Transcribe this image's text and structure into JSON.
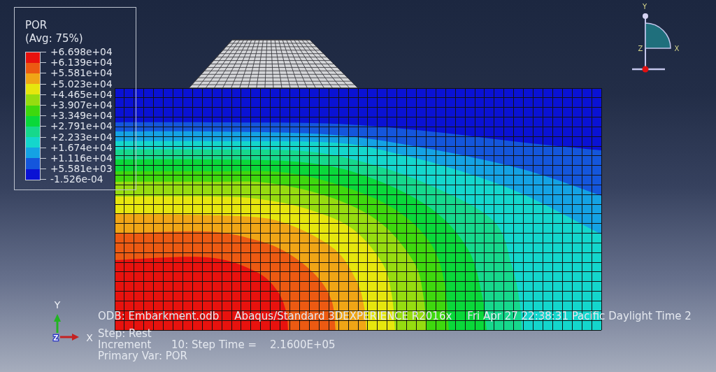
{
  "legend": {
    "title": "POR",
    "subtitle": "(Avg: 75%)",
    "bands": [
      {
        "color": "#e8120e"
      },
      {
        "color": "#ec5a12"
      },
      {
        "color": "#f0a516"
      },
      {
        "color": "#e6e60e"
      },
      {
        "color": "#96dc10"
      },
      {
        "color": "#3ed80e"
      },
      {
        "color": "#0ad83a"
      },
      {
        "color": "#16d88c"
      },
      {
        "color": "#14d6cc"
      },
      {
        "color": "#14a2e4"
      },
      {
        "color": "#1456dc"
      },
      {
        "color": "#0a12d4"
      }
    ],
    "values": [
      "+6.698e+04",
      "+6.139e+04",
      "+5.581e+04",
      "+5.023e+04",
      "+4.465e+04",
      "+3.907e+04",
      "+3.349e+04",
      "+2.791e+04",
      "+2.233e+04",
      "+1.674e+04",
      "+1.116e+04",
      "+5.581e+03",
      "-1.526e-04"
    ]
  },
  "view_glyph": {
    "y_label": "Y",
    "z_label": "Z",
    "x_label": "X"
  },
  "axis_triad": {
    "y_label": "Y",
    "x_label": "X",
    "z_label": "Z"
  },
  "info": {
    "odb": "ODB: Embarkment.odb",
    "solver": "Abaqus/Standard 3DEXPERIENCE R2016x",
    "date": "Fri Apr 27 22:38:31 Pacific Daylight Time 2",
    "step": "Step: Rest",
    "increment": "Increment      10: Step Time =    2.1600E+05",
    "primary_var": "Primary Var: POR"
  }
}
